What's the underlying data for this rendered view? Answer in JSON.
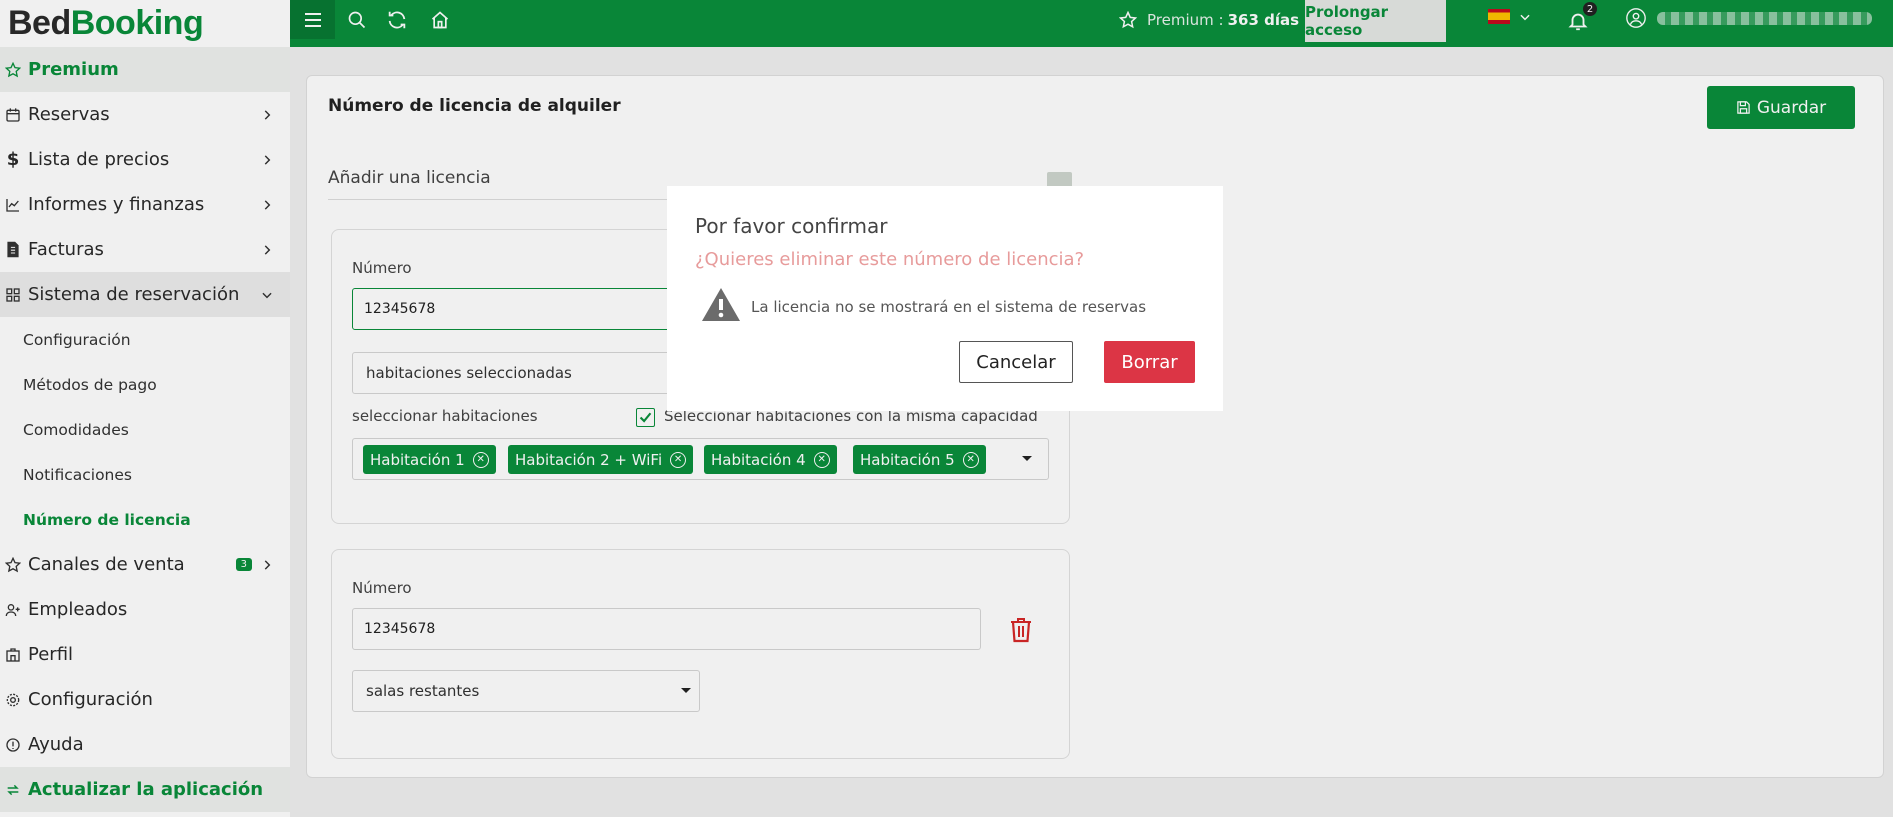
{
  "brand": {
    "part1": "Bed",
    "part2": "Booking"
  },
  "colors": {
    "brand_green": "#0a8f3c",
    "danger": "#dc3545",
    "question": "#e79b9b"
  },
  "sidebar": {
    "premium": "Premium",
    "items": [
      {
        "label": "Reservas",
        "icon": "calendar-icon"
      },
      {
        "label": "Lista de precios",
        "icon": "dollar-icon"
      },
      {
        "label": "Informes y finanzas",
        "icon": "chart-icon"
      },
      {
        "label": "Facturas",
        "icon": "invoice-icon"
      },
      {
        "label": "Sistema de reservación",
        "icon": "grid-icon"
      }
    ],
    "sub_items": [
      {
        "label": "Configuración"
      },
      {
        "label": "Métodos de pago"
      },
      {
        "label": "Comodidades"
      },
      {
        "label": "Notificaciones"
      },
      {
        "label": "Número de licencia"
      }
    ],
    "channels": {
      "label": "Canales de venta",
      "badge": "3"
    },
    "employees": "Empleados",
    "profile": "Perfil",
    "settings": "Configuración",
    "help": "Ayuda",
    "update_app": "Actualizar la aplicación"
  },
  "topbar": {
    "premium_label": "Premium :",
    "premium_days": "363 días",
    "prolong": "Prolongar acceso",
    "notif_count": "2"
  },
  "main": {
    "title": "Número de licencia de alquiler",
    "save": "Guardar",
    "add_license": "Añadir una licencia",
    "license1": {
      "number_label": "Número",
      "number_value": "12345678",
      "rooms_select": "habitaciones seleccionadas",
      "select_rooms_label": "seleccionar habitaciones",
      "same_capacity": "Seleccionar habitaciones con la misma capacidad",
      "tags": [
        "Habitación 1",
        "Habitación 2 + WiFi",
        "Habitación 4",
        "Habitación 5"
      ]
    },
    "license2": {
      "number_label": "Número",
      "number_value": "12345678",
      "rooms_select": "salas restantes"
    }
  },
  "modal": {
    "title": "Por favor confirmar",
    "question": "¿Quieres eliminar este número de licencia?",
    "warning": "La licencia no se mostrará en el sistema de reservas",
    "cancel": "Cancelar",
    "delete": "Borrar"
  }
}
